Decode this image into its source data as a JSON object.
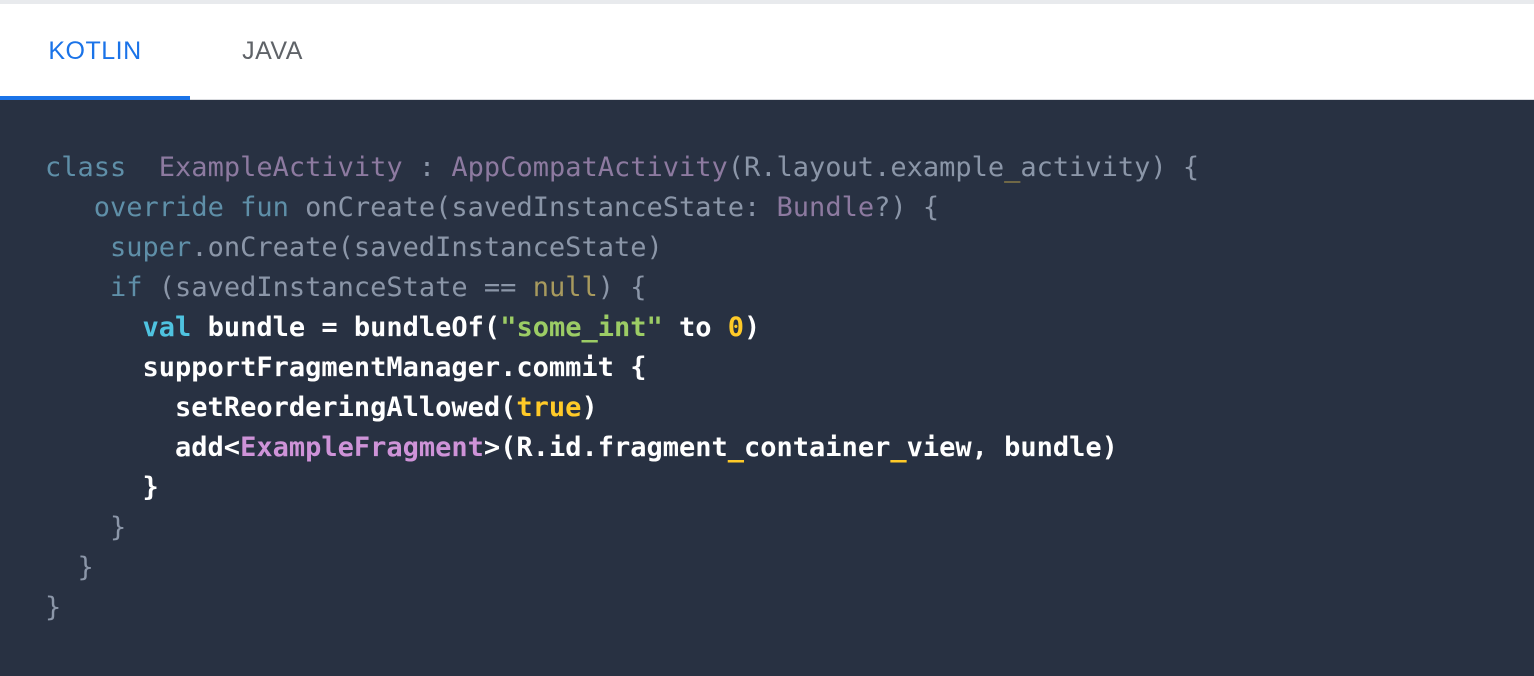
{
  "tabs": [
    {
      "label": "KOTLIN",
      "active": true
    },
    {
      "label": "JAVA",
      "active": false
    }
  ],
  "colors": {
    "accent": "#1a73e8",
    "code_background": "#283142",
    "keyword": "#4fc3e0",
    "string": "#9ccc65",
    "number": "#ffca28",
    "type": "#ce93d8"
  },
  "code": {
    "language": "kotlin",
    "lines": [
      {
        "dim": true,
        "tokens": [
          [
            "kw",
            "class"
          ],
          [
            "",
            "  "
          ],
          [
            "type",
            "ExampleActivity"
          ],
          [
            "",
            " : "
          ],
          [
            "type",
            "AppCompatActivity"
          ],
          [
            "",
            "(R.layout.example"
          ],
          [
            "us",
            "_"
          ],
          [
            "",
            "activity) {"
          ]
        ]
      },
      {
        "dim": true,
        "tokens": [
          [
            "",
            "   "
          ],
          [
            "kw",
            "override"
          ],
          [
            "",
            " "
          ],
          [
            "kw",
            "fun"
          ],
          [
            "",
            " onCreate(savedInstanceState: "
          ],
          [
            "type",
            "Bundle"
          ],
          [
            "",
            "?) {"
          ]
        ]
      },
      {
        "dim": true,
        "tokens": [
          [
            "",
            "    "
          ],
          [
            "kw",
            "super"
          ],
          [
            "",
            ".onCreate(savedInstanceState)"
          ]
        ]
      },
      {
        "dim": true,
        "tokens": [
          [
            "",
            "    "
          ],
          [
            "kw",
            "if"
          ],
          [
            "",
            " (savedInstanceState == "
          ],
          [
            "lit",
            "null"
          ],
          [
            "",
            ") {"
          ]
        ]
      },
      {
        "dim": false,
        "tokens": [
          [
            "",
            "      "
          ],
          [
            "kw",
            "val"
          ],
          [
            "",
            " bundle = bundleOf("
          ],
          [
            "str",
            "\"some_int\""
          ],
          [
            "",
            " to "
          ],
          [
            "num",
            "0"
          ],
          [
            "",
            ")"
          ]
        ]
      },
      {
        "dim": false,
        "tokens": [
          [
            "",
            "      supportFragmentManager.commit {"
          ]
        ]
      },
      {
        "dim": false,
        "tokens": [
          [
            "",
            "        setReorderingAllowed("
          ],
          [
            "lit",
            "true"
          ],
          [
            "",
            ")"
          ]
        ]
      },
      {
        "dim": false,
        "tokens": [
          [
            "",
            "        add<"
          ],
          [
            "type",
            "ExampleFragment"
          ],
          [
            "",
            ">(R.id.fragment"
          ],
          [
            "us",
            "_"
          ],
          [
            "",
            "container"
          ],
          [
            "us",
            "_"
          ],
          [
            "",
            "view, bundle)"
          ]
        ]
      },
      {
        "dim": false,
        "tokens": [
          [
            "",
            "      }"
          ]
        ]
      },
      {
        "dim": true,
        "tokens": [
          [
            "",
            "    }"
          ]
        ]
      },
      {
        "dim": true,
        "tokens": [
          [
            "",
            "  }"
          ]
        ]
      },
      {
        "dim": true,
        "tokens": [
          [
            "",
            "}"
          ]
        ]
      }
    ]
  }
}
